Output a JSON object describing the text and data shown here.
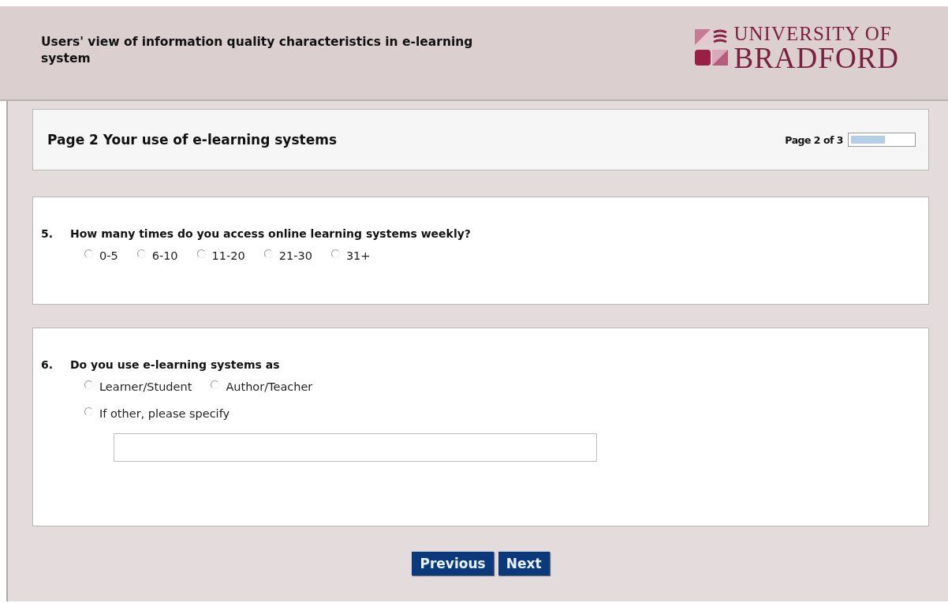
{
  "header": {
    "title": "Users' view of information quality characteristics in e-learning system",
    "logo": {
      "line_1": "UNIVERSITY OF",
      "line_2": "BRADFORD"
    }
  },
  "page_header": {
    "title": "Page 2 Your use of e-learning systems",
    "progress_text": "Page 2 of 3",
    "level": 0.55
  },
  "questions": [
    {
      "number": "5.",
      "text": "How many times do you access online learning systems weekly?",
      "options": [
        {
          "label": "0-5",
          "selected": false
        },
        {
          "label": "6-10",
          "selected": false
        },
        {
          "label": "11-20",
          "selected": false
        },
        {
          "label": "21-30",
          "selected": false
        },
        {
          "label": "31+",
          "selected": false
        }
      ]
    },
    {
      "number": "6.",
      "text": "Do you use e-learning systems as",
      "options": [
        {
          "label": "Learner/Student",
          "selected": false
        },
        {
          "label": "Author/Teacher",
          "selected": false
        }
      ],
      "other": {
        "label": "If other, please specify",
        "selected": false
      }
    }
  ],
  "buttons": [
    "Previous",
    "Next"
  ]
}
